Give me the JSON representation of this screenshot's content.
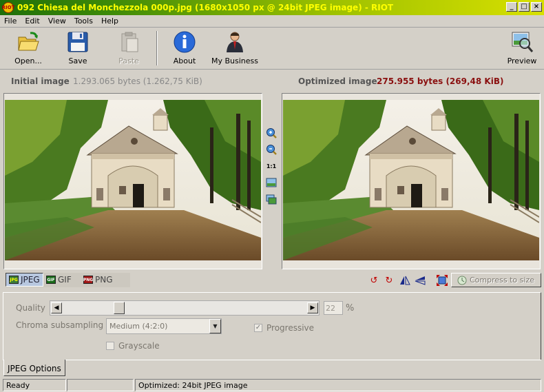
{
  "window": {
    "title": "092 Chiesa del Monchezzola 000p.jpg (1680x1050 px @ 24bit JPEG image) - RIOT",
    "controls": [
      "_",
      "□",
      "×"
    ]
  },
  "menu": [
    "File",
    "Edit",
    "View",
    "Tools",
    "Help"
  ],
  "toolbar": {
    "open": "Open...",
    "save": "Save",
    "paste": "Paste",
    "about": "About",
    "business": "My Business",
    "preview": "Preview"
  },
  "info": {
    "initial_label": "Initial image",
    "initial_size": "1.293.065 bytes (1.262,75 KiB)",
    "optimized_label": "Optimized image",
    "optimized_size": "275.955 bytes (269,48 KiB)"
  },
  "vtools": {
    "actual_size": "1:1"
  },
  "formats": {
    "jpeg": "JPEG",
    "gif": "GIF",
    "png": "PNG",
    "selected": "JPEG"
  },
  "compress": "Compress to size",
  "options": {
    "quality_label": "Quality",
    "quality_value": "22",
    "quality_unit": "%",
    "chroma_label": "Chroma subsampling",
    "chroma_value": "Medium (4:2:0)",
    "progressive_label": "Progressive",
    "progressive_checked": true,
    "grayscale_label": "Grayscale",
    "grayscale_checked": false,
    "tab_label": "JPEG Options"
  },
  "status": {
    "state": "Ready",
    "middle": "",
    "detail": "Optimized: 24bit JPEG image"
  }
}
